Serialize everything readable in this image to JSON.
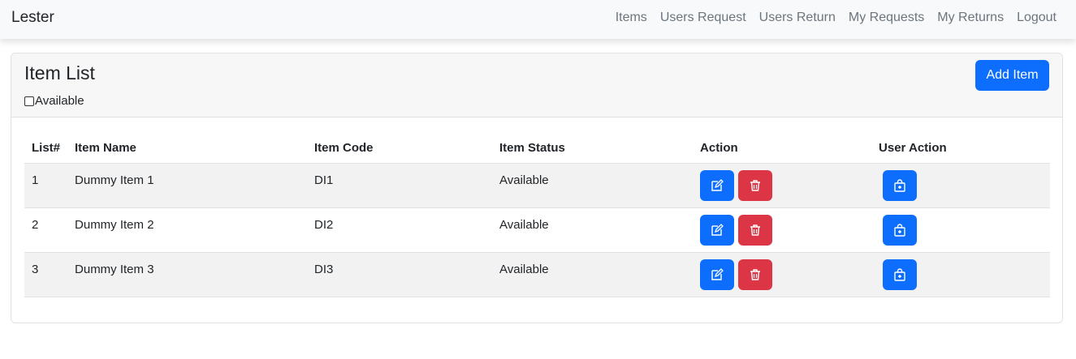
{
  "navbar": {
    "brand": "Lester",
    "links": [
      "Items",
      "Users Request",
      "Users Return",
      "My Requests",
      "My Returns",
      "Logout"
    ]
  },
  "card": {
    "title": "Item List",
    "filter_label": "Available",
    "add_button_label": "Add Item"
  },
  "table": {
    "columns": [
      "List#",
      "Item Name",
      "Item Code",
      "Item Status",
      "Action",
      "User Action"
    ],
    "rows": [
      {
        "list": "1",
        "name": "Dummy Item 1",
        "code": "DI1",
        "status": "Available"
      },
      {
        "list": "2",
        "name": "Dummy Item 2",
        "code": "DI2",
        "status": "Available"
      },
      {
        "list": "3",
        "name": "Dummy Item 3",
        "code": "DI3",
        "status": "Available"
      }
    ]
  },
  "icons": {
    "edit": "edit-icon",
    "delete": "trash-icon",
    "request": "bag-plus-icon"
  },
  "colors": {
    "primary": "#0d6efd",
    "danger": "#dc3545",
    "navbar_bg": "#f8f9fa"
  }
}
